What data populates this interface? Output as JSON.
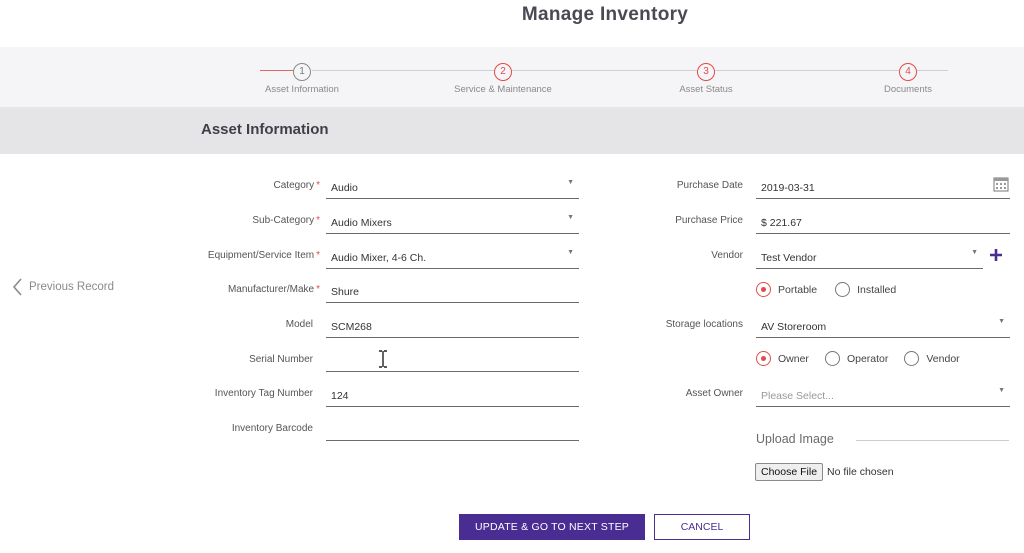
{
  "page": {
    "title": "Manage Inventory"
  },
  "stepper": {
    "steps": [
      {
        "number": "1",
        "label": "Asset Information"
      },
      {
        "number": "2",
        "label": "Service & Maintenance"
      },
      {
        "number": "3",
        "label": "Asset Status"
      },
      {
        "number": "4",
        "label": "Documents"
      }
    ]
  },
  "section": {
    "title": "Asset Information"
  },
  "nav": {
    "previous_label": "Previous Record"
  },
  "left_fields": {
    "category": {
      "label": "Category",
      "value": "Audio"
    },
    "sub_category": {
      "label": "Sub-Category",
      "value": "Audio Mixers"
    },
    "equipment": {
      "label": "Equipment/Service Item",
      "value": "Audio Mixer, 4-6 Ch."
    },
    "manufacturer": {
      "label": "Manufacturer/Make",
      "value": "Shure"
    },
    "model": {
      "label": "Model",
      "value": "SCM268"
    },
    "serial": {
      "label": "Serial Number",
      "value": ""
    },
    "tag": {
      "label": "Inventory Tag Number",
      "value": "124"
    },
    "barcode": {
      "label": "Inventory Barcode",
      "value": ""
    }
  },
  "required_mark": "*",
  "right_fields": {
    "purchase_date": {
      "label": "Purchase Date",
      "value": "2019-03-31"
    },
    "purchase_price": {
      "label": "Purchase Price",
      "value": "$ 221.67"
    },
    "vendor": {
      "label": "Vendor",
      "value": "Test Vendor"
    },
    "mobility": {
      "options": [
        "Portable",
        "Installed"
      ],
      "selected": "Portable"
    },
    "storage": {
      "label": "Storage locations",
      "value": "AV Storeroom"
    },
    "ownership": {
      "options": [
        "Owner",
        "Operator",
        "Vendor"
      ],
      "selected": "Owner"
    },
    "asset_owner": {
      "label": "Asset Owner",
      "placeholder": "Please Select..."
    }
  },
  "upload": {
    "title": "Upload Image",
    "button_label": "Choose File",
    "status": "No file chosen"
  },
  "actions": {
    "primary_label": "UPDATE & GO TO NEXT STEP",
    "cancel_label": "CANCEL"
  },
  "colors": {
    "accent": "#4a2d93",
    "required": "#e24b4b",
    "section_bg": "#e5e5e8",
    "stepper_bg": "#f5f5f7"
  }
}
